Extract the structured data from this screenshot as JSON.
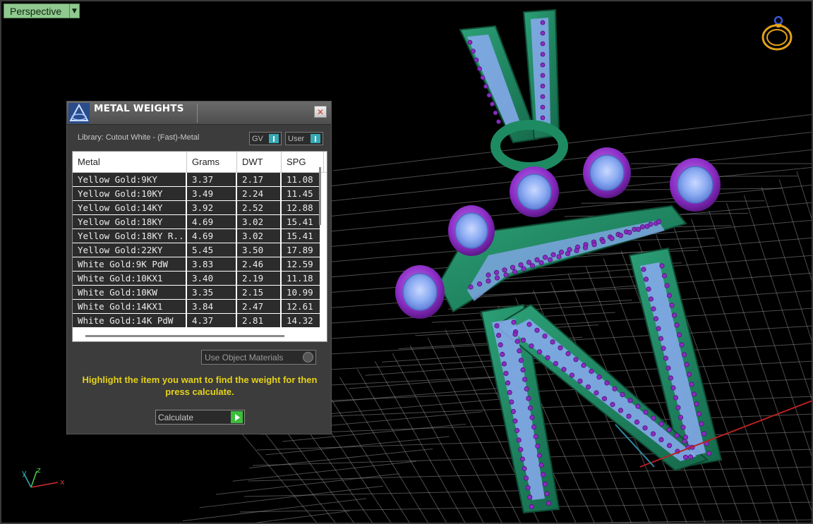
{
  "viewport": {
    "label": "Perspective",
    "axes": {
      "x": "x",
      "y": "y",
      "z": "z"
    }
  },
  "dialog": {
    "title": "METAL WEIGHTS",
    "close_label": "✕",
    "library": "Library: Cutout White - (Fast)-Metal",
    "gv_label": "GV",
    "user_label": "User",
    "columns": [
      "Metal",
      "Grams",
      "DWT",
      "SPG"
    ],
    "rows": [
      [
        "Yellow Gold:9KY",
        "3.37",
        "2.17",
        "11.08"
      ],
      [
        "Yellow Gold:10KY",
        "3.49",
        "2.24",
        "11.45"
      ],
      [
        "Yellow Gold:14KY",
        "3.92",
        "2.52",
        "12.88"
      ],
      [
        "Yellow Gold:18KY",
        "4.69",
        "3.02",
        "15.41"
      ],
      [
        "Yellow Gold:18KY R...",
        "4.69",
        "3.02",
        "15.41"
      ],
      [
        "Yellow Gold:22KY",
        "5.45",
        "3.50",
        "17.89"
      ],
      [
        "White Gold:9K PdW",
        "3.83",
        "2.46",
        "12.59"
      ],
      [
        "White Gold:10KX1",
        "3.40",
        "2.19",
        "11.18"
      ],
      [
        "White Gold:10KW",
        "3.35",
        "2.15",
        "10.99"
      ],
      [
        "White Gold:14KX1",
        "3.84",
        "2.47",
        "12.61"
      ],
      [
        "White Gold:14K PdW",
        "4.37",
        "2.81",
        "14.32"
      ]
    ],
    "material_dropdown": "Use Object Materials",
    "hint": "Highlight the item you want to find the weight for then press calculate.",
    "calculate_label": "Calculate"
  },
  "colors": {
    "metal_green": "#1e8a62",
    "gem_blue": "#8aaaf2",
    "prong_purple": "#8a2cc4",
    "hint_yellow": "#e6d21a",
    "go_green": "#3cbd3c",
    "toggle_teal": "#35a9b6"
  },
  "icons": [
    "ring-icon",
    "dialog-app-icon",
    "close-icon",
    "dropdown-arrow-icon",
    "calculate-go-icon"
  ]
}
